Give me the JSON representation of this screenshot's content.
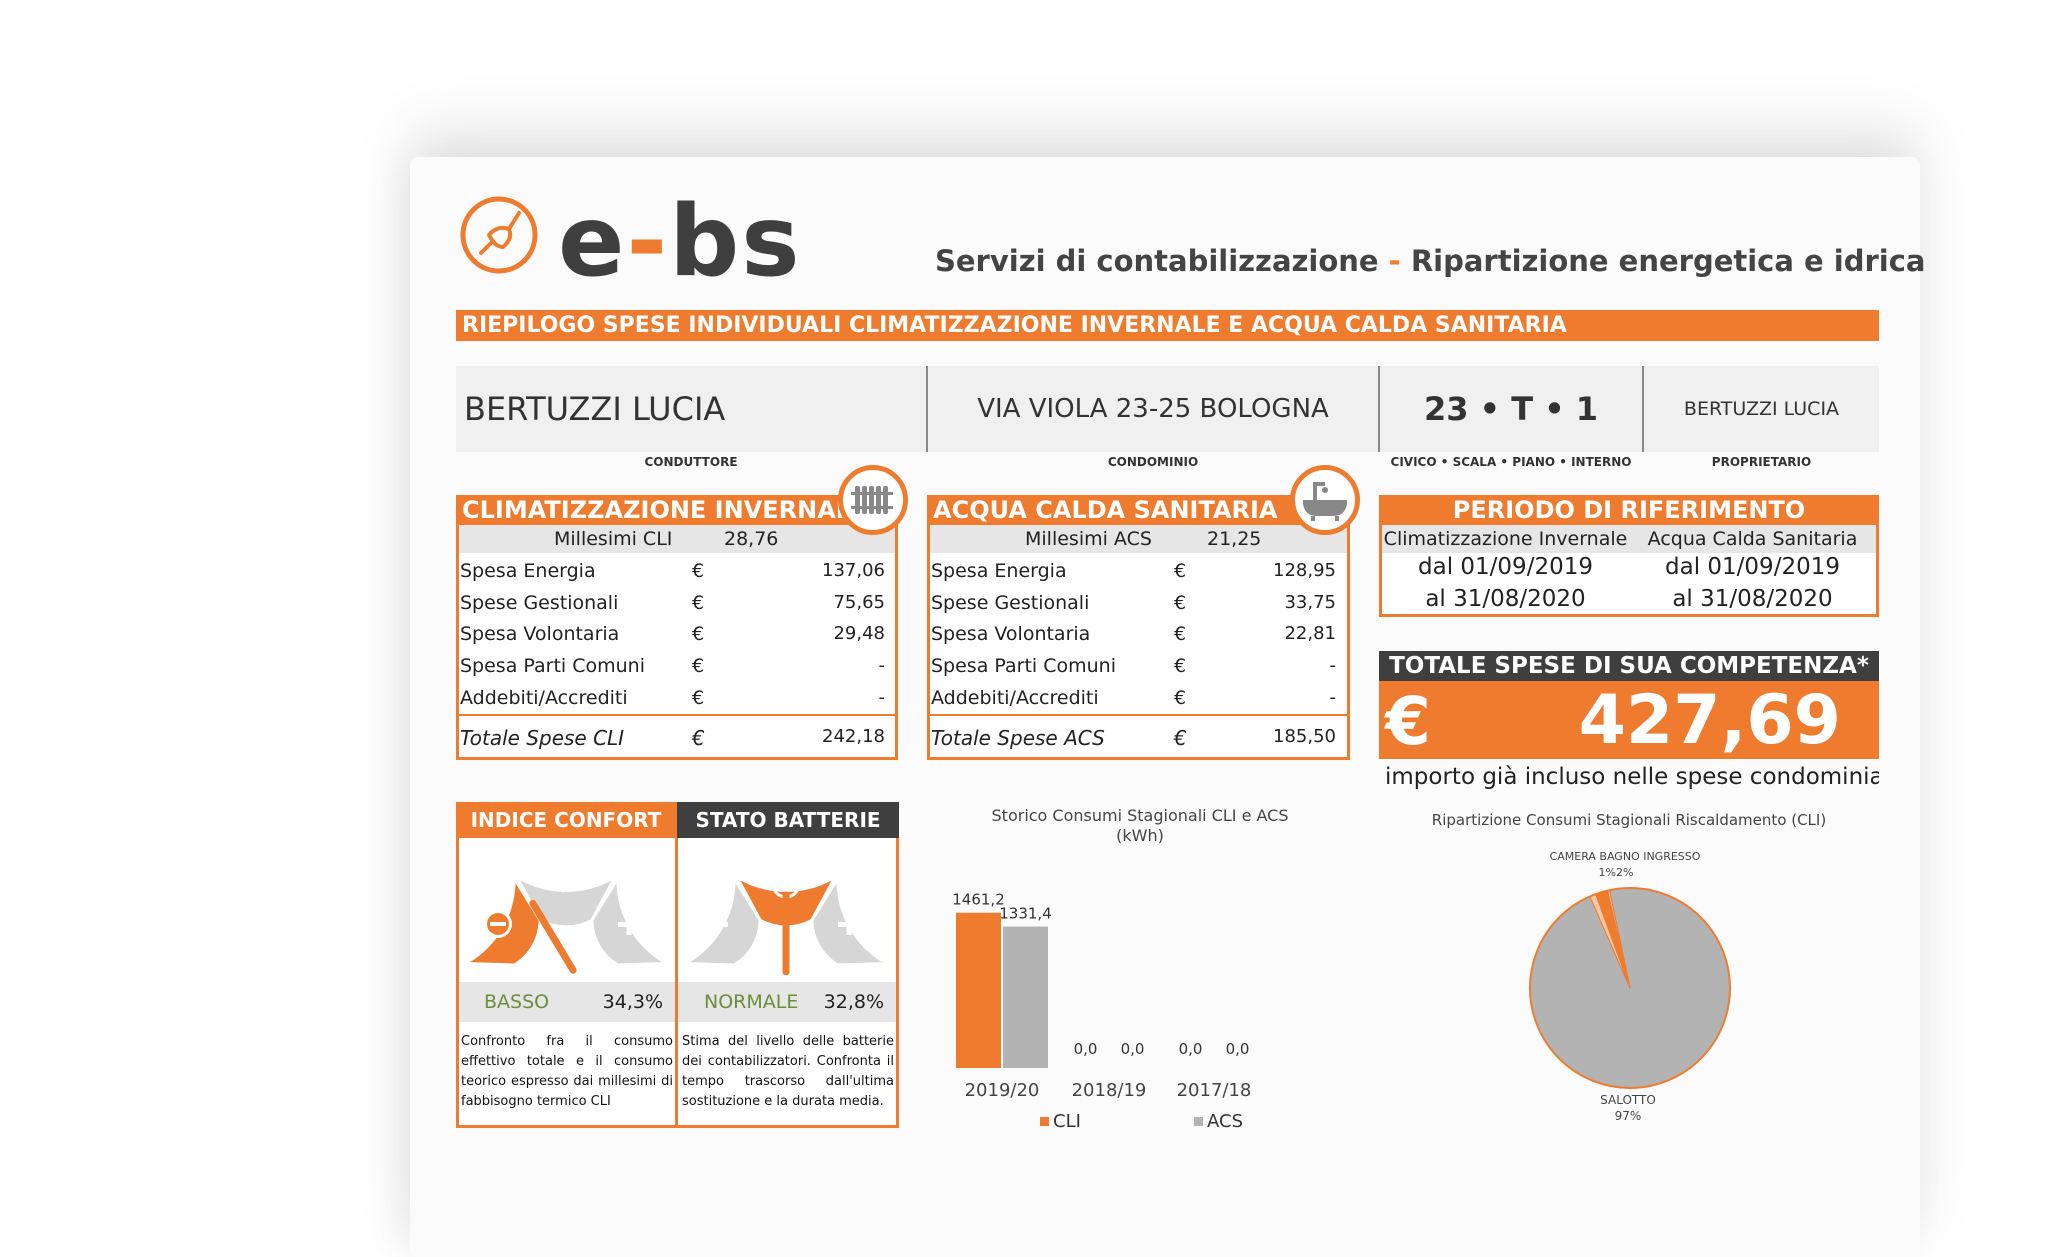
{
  "header": {
    "logo_text_a": "e",
    "logo_text_dash": "-",
    "logo_text_b": "bs",
    "tagline_a": "Servizi di contabilizzazione",
    "tagline_sep": " - ",
    "tagline_b": "Ripartizione energetica e idrica",
    "banner": "RIEPILOGO SPESE INDIVIDUALI CLIMATIZZAZIONE INVERNALE E ACQUA CALDA SANITARIA"
  },
  "info": {
    "conduttore_value": "BERTUZZI LUCIA",
    "conduttore_label": "CONDUTTORE",
    "condominio_value": "VIA VIOLA 23-25 BOLOGNA",
    "condominio_label": "CONDOMINIO",
    "civico_value": "23 • T • 1",
    "civico_label": "CIVICO • SCALA • PIANO • INTERNO",
    "proprietario_value": "BERTUZZI LUCIA",
    "proprietario_label": "PROPRIETARIO"
  },
  "cli": {
    "title": "CLIMATIZZAZIONE INVERNALE",
    "millesimi_label": "Millesimi CLI",
    "millesimi_value": "28,76",
    "rows": [
      {
        "label": "Spesa Energia",
        "cur": "€",
        "value": "137,06"
      },
      {
        "label": "Spese Gestionali",
        "cur": "€",
        "value": "75,65"
      },
      {
        "label": "Spesa Volontaria",
        "cur": "€",
        "value": "29,48"
      },
      {
        "label": "Spesa Parti Comuni",
        "cur": "€",
        "value": "-"
      },
      {
        "label": "Addebiti/Accrediti",
        "cur": "€",
        "value": "-"
      }
    ],
    "total_label": "Totale Spese CLI",
    "total_cur": "€",
    "total_value": "242,18"
  },
  "acs": {
    "title": "ACQUA CALDA SANITARIA",
    "millesimi_label": "Millesimi ACS",
    "millesimi_value": "21,25",
    "rows": [
      {
        "label": "Spesa Energia",
        "cur": "€",
        "value": "128,95"
      },
      {
        "label": "Spese Gestionali",
        "cur": "€",
        "value": "33,75"
      },
      {
        "label": "Spesa Volontaria",
        "cur": "€",
        "value": "22,81"
      },
      {
        "label": "Spesa Parti Comuni",
        "cur": "€",
        "value": "-"
      },
      {
        "label": "Addebiti/Accrediti",
        "cur": "€",
        "value": "-"
      }
    ],
    "total_label": "Totale Spese ACS",
    "total_cur": "€",
    "total_value": "185,50"
  },
  "periodo": {
    "title": "PERIODO DI RIFERIMENTO",
    "col1_head": "Climatizzazione Invernale",
    "col2_head": "Acqua Calda Sanitaria",
    "col1_from": "dal 01/09/2019",
    "col1_to": "al 31/08/2020",
    "col2_from": "dal 01/09/2019",
    "col2_to": "al 31/08/2020"
  },
  "totale": {
    "title": "TOTALE SPESE DI SUA COMPETENZA*",
    "currency": "€",
    "value": "427,69",
    "note": "importo già incluso nelle spese condominiali"
  },
  "confort": {
    "title": "INDICE CONFORT",
    "status": "BASSO",
    "percent": "34,3%",
    "level": 0.343,
    "description": "Confronto fra il consumo effettivo totale e il consumo teorico espresso dai millesimi di fabbisogno termico CLI"
  },
  "batterie": {
    "title": "STATO BATTERIE",
    "status": "NORMALE",
    "percent": "32,8%",
    "level": 0.5,
    "description": "Stima del livello delle batterie dei contabilizzatori. Confronta il tempo trascorso dall'ultima sostituzione e la durata media."
  },
  "colors": {
    "accent": "#ef7b2f",
    "dark": "#3f3f3f",
    "grey": "#b3b3b3",
    "light_grey": "#e6e6e6",
    "status_green": "#6b8e3a"
  },
  "chart_data": [
    {
      "type": "bar",
      "title": "Storico Consumi Stagionali CLI e ACS",
      "subtitle": "(kWh)",
      "categories": [
        "2019/20",
        "2018/19",
        "2017/18"
      ],
      "series": [
        {
          "name": "CLI",
          "values": [
            1461.2,
            0.0,
            0.0
          ],
          "labels": [
            "1461,2",
            "0,0",
            "0,0"
          ],
          "color": "#ef7b2f"
        },
        {
          "name": "ACS",
          "values": [
            1331.4,
            0.0,
            0.0
          ],
          "labels": [
            "1331,4",
            "0,0",
            "0,0"
          ],
          "color": "#b3b3b3"
        }
      ],
      "ylim": [
        0,
        1600
      ],
      "grid": false,
      "legend": "bottom"
    },
    {
      "type": "pie",
      "title": "Ripartizione Consumi Stagionali Riscaldamento (CLI)",
      "slices": [
        {
          "name": "SALOTTO",
          "value": 97,
          "label": "97%",
          "color": "#b3b3b3"
        },
        {
          "name": "CAMERA",
          "value": 1,
          "label": "1%",
          "color": "#f7c9a6"
        },
        {
          "name": "BAGNO",
          "value": 2,
          "label": "2%",
          "color": "#ef7b2f"
        },
        {
          "name": "INGRESSO",
          "value": 0.3,
          "label": "",
          "color": "#d9d9d9"
        }
      ],
      "top_labels_text": "CAMERA BAGNO INGRESSO",
      "top_percent_text": "1%2%"
    }
  ]
}
